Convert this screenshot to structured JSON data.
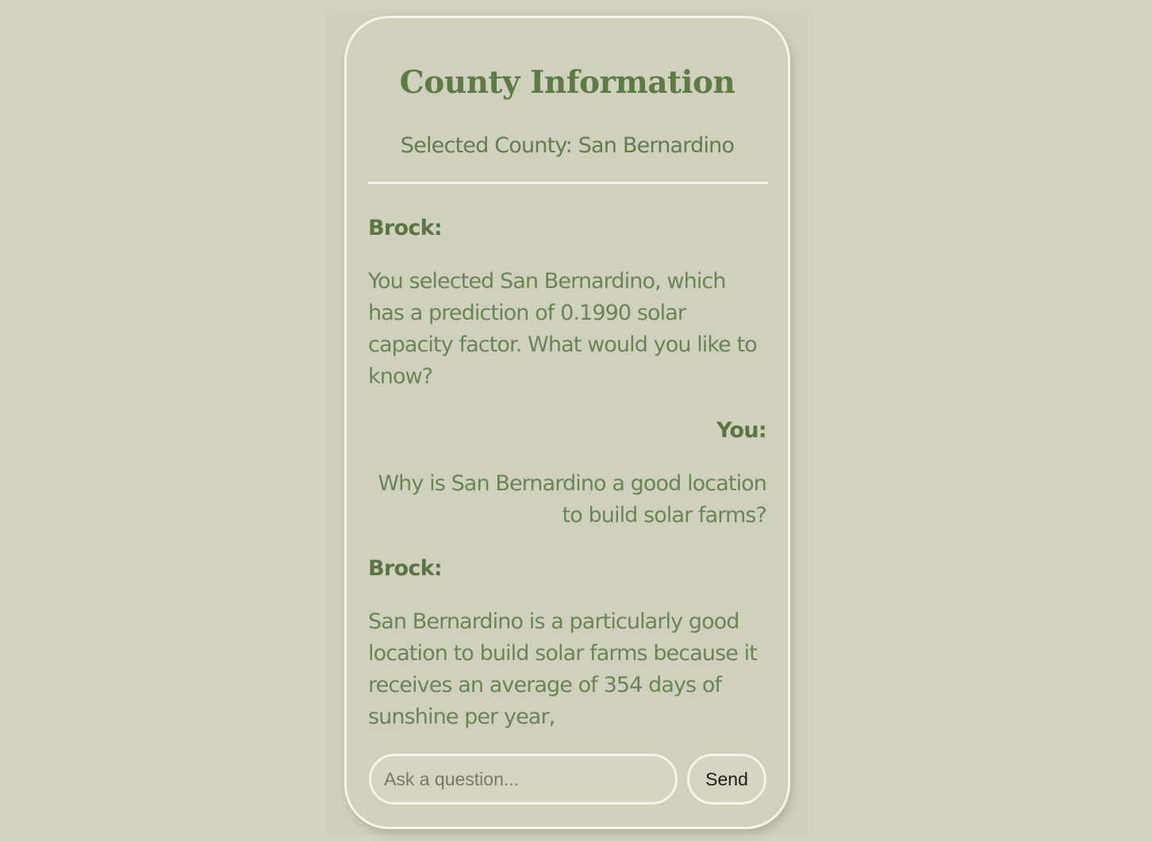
{
  "panel": {
    "title": "County Information",
    "selected_county": "Selected County: San Bernardino"
  },
  "chat": {
    "messages": [
      {
        "sender": "Brock:",
        "role": "assistant",
        "text": "You selected San Bernardino, which has a prediction of 0.1990 solar capacity factor. What would you like to know?"
      },
      {
        "sender": "You:",
        "role": "user",
        "text": "Why is San Bernardino a good location to build solar farms?"
      },
      {
        "sender": "Brock:",
        "role": "assistant",
        "text": "San Bernardino is a particularly good location to build solar farms because it receives an average of 354 days of sunshine per year,"
      }
    ]
  },
  "input": {
    "placeholder": "Ask a question...",
    "value": ""
  },
  "send_button": {
    "label": "Send"
  },
  "colors": {
    "page_background": "#d1d2c0",
    "panel_background": "#d0d1bd",
    "panel_border": "#f4f4ea",
    "title_green": "#5d7a47",
    "text_green": "#6b8456"
  }
}
